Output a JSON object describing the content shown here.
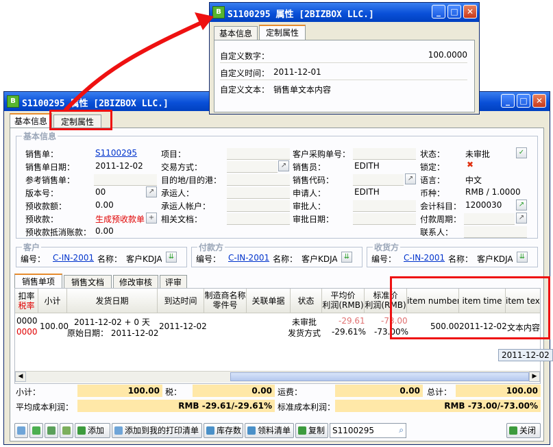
{
  "main_window": {
    "title": "S1100295 属性 [2BIZBOX LLC.]",
    "app_icon": "B",
    "tabs": [
      {
        "label": "基本信息"
      },
      {
        "label": "定制属性"
      }
    ],
    "basic_group_title": "基本信息",
    "fields": {
      "sales_order": {
        "label": "销售单：",
        "value": "S1100295"
      },
      "order_date": {
        "label": "销售单日期：",
        "value": "2011-12-02"
      },
      "ref_order": {
        "label": "参考销售单："
      },
      "version": {
        "label": "版本号：",
        "value": "00"
      },
      "prepay_amount": {
        "label": "预收款额：",
        "value": "0.00"
      },
      "prepay": {
        "label": "预收款：",
        "value": "生成预收款单"
      },
      "prepay_offset": {
        "label": "预收款抵消账款：",
        "value": "0.00"
      },
      "item": {
        "label": "项目："
      },
      "trade_method": {
        "label": "交易方式："
      },
      "destination": {
        "label": "目的地/目的港："
      },
      "carrier": {
        "label": "承运人："
      },
      "carrier_account": {
        "label": "承运人帐户："
      },
      "related_docs": {
        "label": "相关文档："
      },
      "customer_po": {
        "label": "客户采购单号："
      },
      "salesperson": {
        "label": "销售员：",
        "value": "EDITH"
      },
      "sales_code": {
        "label": "销售代码："
      },
      "applicant": {
        "label": "申请人：",
        "value": "EDITH"
      },
      "approver": {
        "label": "审批人："
      },
      "approve_date": {
        "label": "审批日期："
      },
      "status": {
        "label": "状态：",
        "value": "未审批"
      },
      "locked": {
        "label": "锁定："
      },
      "language": {
        "label": "语言：",
        "value": "中文"
      },
      "currency": {
        "label": "币种：",
        "value": "RMB / 1.0000"
      },
      "account": {
        "label": "会计科目：",
        "value": "1200030"
      },
      "pay_period": {
        "label": "付款周期："
      },
      "contact": {
        "label": "联系人："
      }
    },
    "parties": {
      "customer": {
        "title": "客户",
        "code_label": "编号：",
        "code": "C-IN-2001",
        "name_label": "名称：",
        "name": "客户KDJA"
      },
      "payer": {
        "title": "付款方",
        "code_label": "编号：",
        "code": "C-IN-2001",
        "name_label": "名称：",
        "name": "客户KDJA"
      },
      "receiver": {
        "title": "收货方",
        "code_label": "编号：",
        "code": "C-IN-2001",
        "name_label": "名称：",
        "name": "客户KDJA"
      }
    },
    "lower_tabs": [
      {
        "label": "销售单项"
      },
      {
        "label": "销售文档"
      },
      {
        "label": "修改审核"
      },
      {
        "label": "评审"
      }
    ],
    "grid": {
      "headers": {
        "discount": "扣率",
        "discount2": "税率",
        "subtotal": "小计",
        "ship_date": "发货日期",
        "arrive_time": "到达时间",
        "mfr_l1": "制造商名称",
        "mfr_l2": "零件号",
        "related": "关联单据",
        "state": "状态",
        "avg_l1": "平均价",
        "avg_l2": "利润(RMB)",
        "std_l1": "标准价",
        "std_l2": "利润(RMB)",
        "item_number": "item number",
        "item_time": "item time",
        "item_text": "item text"
      },
      "row": {
        "discount": "0000",
        "discount2": "0000",
        "subtotal": "100.00",
        "ship_l1": "2011-12-02 + 0 天",
        "ship_l2": "原始日期： 2011-12-02",
        "arrive": "2011-12-02",
        "state_l1": "未审批",
        "state_l2": "发货方式",
        "avg_l1": "-29.61",
        "avg_l2": "-29.61%",
        "std_l1": "-73.00",
        "std_l2": "-73.00%",
        "item_number": "500.00",
        "item_time": "2011-12-02",
        "item_text": "文本内容"
      },
      "tooltip": "2011-12-02"
    },
    "totals": {
      "subtotal_label": "小计：",
      "subtotal": "100.00",
      "tax_label": "税：",
      "tax": "0.00",
      "freight_label": "运费：",
      "freight": "0.00",
      "total_label": "总计：",
      "total": "100.00",
      "avg_profit_label": "平均成本利润：",
      "avg_profit": "RMB -29.61/-29.61%",
      "std_profit_label": "标准成本利润：",
      "std_profit": "RMB -73.00/-73.00%"
    },
    "toolbar": {
      "add": "添加",
      "add_print": "添加到我的打印清单",
      "stock": "库存数",
      "pick_list": "领料清单",
      "copy": "复制",
      "search_value": "S1100295",
      "close": "关闭"
    }
  },
  "popup_window": {
    "title": "S1100295 属性 [2BIZBOX LLC.]",
    "app_icon": "B",
    "tabs": [
      {
        "label": "基本信息"
      },
      {
        "label": "定制属性"
      }
    ],
    "fields": {
      "custom_number": {
        "label": "自定义数字：",
        "value": "100.0000"
      },
      "custom_time": {
        "label": "自定义时间：",
        "value": "2011-12-01"
      },
      "custom_text": {
        "label": "自定义文本：",
        "value": "销售单文本内容"
      }
    }
  },
  "colors": {
    "annotation": "#ee1111",
    "title_bar": "#0a50d8",
    "total_bg": "#ffe8a8",
    "link": "#0033cc"
  }
}
